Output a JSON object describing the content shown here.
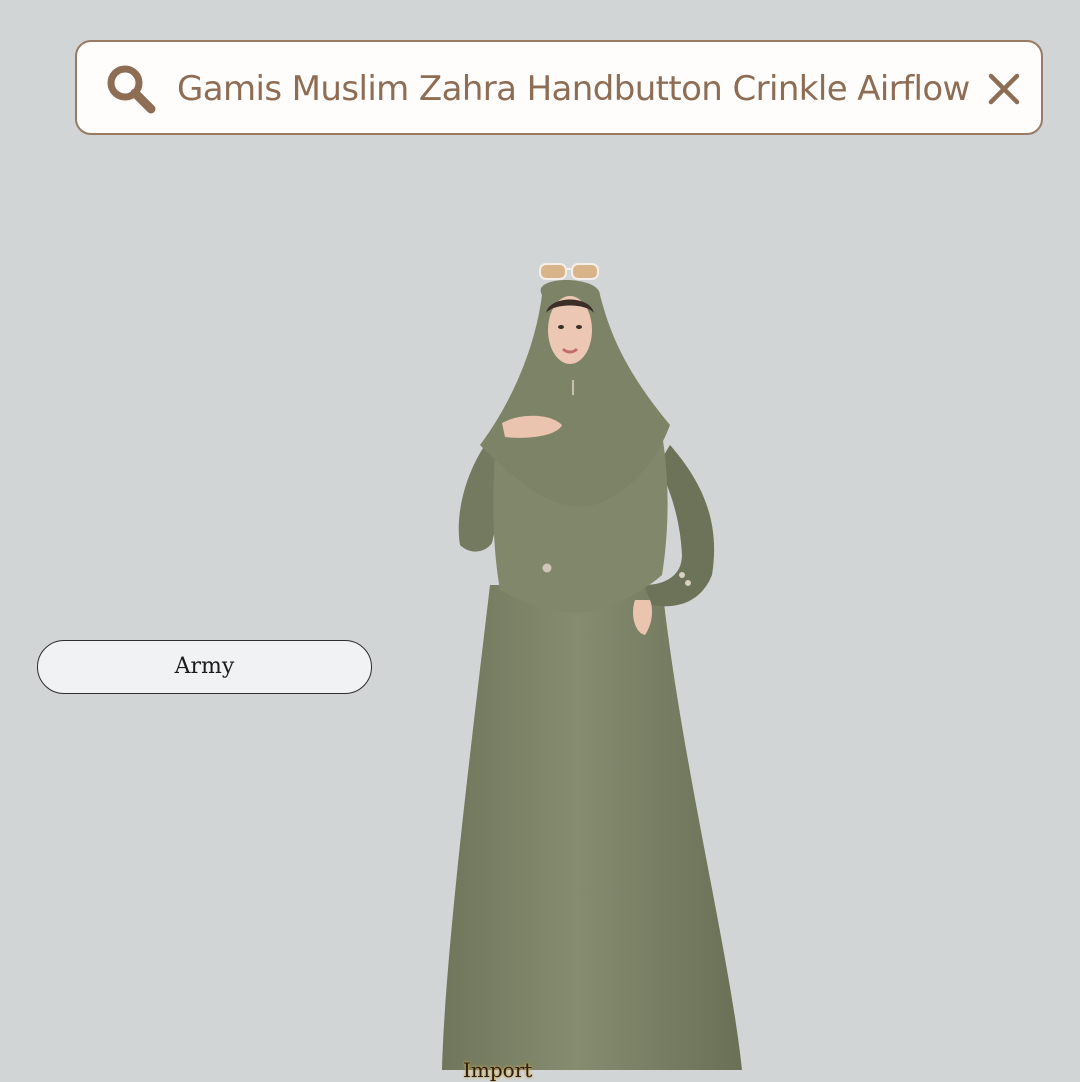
{
  "search": {
    "query": "Gamis Muslim Zahra Handbutton Crinkle Airflow",
    "icon": "search-icon",
    "clear_icon": "close-icon"
  },
  "variant": {
    "label": "Army"
  },
  "product_image": {
    "description_icon": "model-in-olive-dress-photo",
    "watermark": "Import"
  },
  "colors": {
    "background": "#d1d5d6",
    "accent_brown": "#8e6d55",
    "dress_olive": "#7d8468"
  }
}
